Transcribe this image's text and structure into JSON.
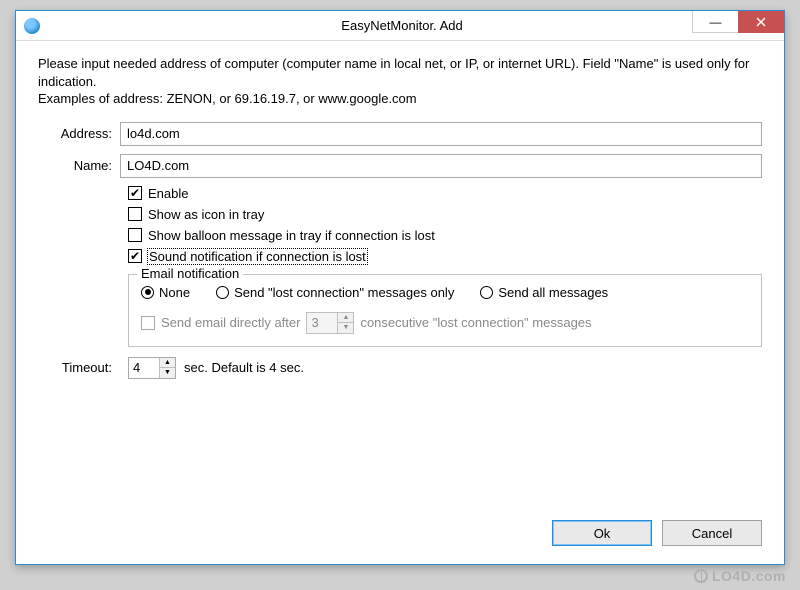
{
  "window": {
    "title": "EasyNetMonitor. Add"
  },
  "instructions": {
    "line1": "Please input needed address of computer (computer name in local net, or IP, or internet URL). Field \"Name\" is used only for indication.",
    "line2": "Examples of address:   ZENON, or  69.16.19.7,  or www.google.com"
  },
  "fields": {
    "address_label": "Address:",
    "address_value": "lo4d.com",
    "name_label": "Name:",
    "name_value": "LO4D.com"
  },
  "checkboxes": {
    "enable": {
      "label": "Enable",
      "checked": true
    },
    "tray_icon": {
      "label": "Show as icon in tray",
      "checked": false
    },
    "balloon": {
      "label": "Show balloon message in tray if connection is lost",
      "checked": false
    },
    "sound": {
      "label": "Sound notification if connection is lost",
      "checked": true
    }
  },
  "email": {
    "legend": "Email notification",
    "options": {
      "none": "None",
      "lost_only": "Send \"lost connection\" messages only",
      "all": "Send all messages"
    },
    "selected": "none",
    "direct": {
      "prefix": "Send email directly after",
      "value": "3",
      "suffix": "consecutive \"lost connection\" messages"
    }
  },
  "timeout": {
    "label": "Timeout:",
    "value": "4",
    "suffix": "sec. Default is 4 sec."
  },
  "buttons": {
    "ok": "Ok",
    "cancel": "Cancel"
  },
  "watermark": "LO4D.com"
}
